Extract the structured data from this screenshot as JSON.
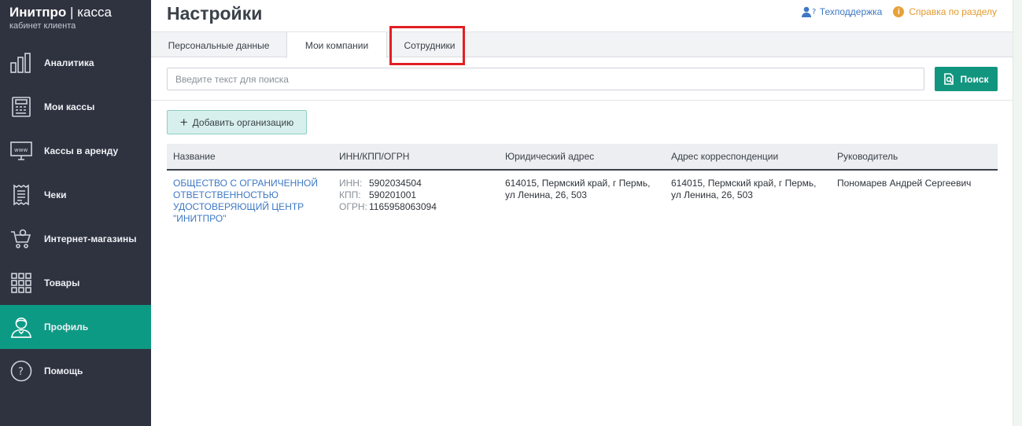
{
  "brand": {
    "name": "Инитпро",
    "separator": "|",
    "product": "касса",
    "subtitle": "кабинет клиента"
  },
  "sidebar": {
    "items": [
      {
        "label": "Аналитика",
        "icon": "bar-chart-icon",
        "active": false
      },
      {
        "label": "Мои кассы",
        "icon": "cash-register-icon",
        "active": false
      },
      {
        "label": "Кассы в аренду",
        "icon": "monitor-www-icon",
        "active": false
      },
      {
        "label": "Чеки",
        "icon": "receipt-icon",
        "active": false
      },
      {
        "label": "Интернет-магазины",
        "icon": "shopping-cart-icon",
        "active": false
      },
      {
        "label": "Товары",
        "icon": "grid-icon",
        "active": false
      },
      {
        "label": "Профиль",
        "icon": "user-profile-icon",
        "active": true
      },
      {
        "label": "Помощь",
        "icon": "question-icon",
        "active": false
      }
    ]
  },
  "header": {
    "title": "Настройки",
    "support_label": "Техподдержка",
    "help_label": "Справка по разделу"
  },
  "tabs": [
    {
      "label": "Персональные данные",
      "active": false
    },
    {
      "label": "Мои компании",
      "active": true
    },
    {
      "label": "Сотрудники",
      "active": false
    }
  ],
  "search": {
    "placeholder": "Введите текст для поиска",
    "value": "",
    "button_label": "Поиск"
  },
  "add_button_label": "Добавить организацию",
  "table": {
    "columns": [
      "Название",
      "ИНН/КПП/ОГРН",
      "Юридический адрес",
      "Адрес корреспонденции",
      "Руководитель"
    ],
    "rows": [
      {
        "name": "ОБЩЕСТВО С ОГРАНИЧЕННОЙ ОТВЕТСТВЕННОСТЬЮ УДОСТОВЕРЯЮЩИЙ ЦЕНТР \"ИНИТПРО\"",
        "inn_label": "ИНН:",
        "inn": "5902034504",
        "kpp_label": "КПП:",
        "kpp": "590201001",
        "ogrn_label": "ОГРН:",
        "ogrn": "1165958063094",
        "legal_address": "614015, Пермский край, г Пермь, ул Ленина, 26, 503",
        "mail_address": "614015, Пермский край, г Пермь, ул Ленина, 26, 503",
        "director": "Пономарев Андрей Сергеевич"
      }
    ]
  },
  "colors": {
    "sidebar_bg": "#2f3340",
    "accent": "#0d9a85",
    "link": "#3d78c4",
    "help": "#e29a2e",
    "highlight": "#e01f24"
  }
}
